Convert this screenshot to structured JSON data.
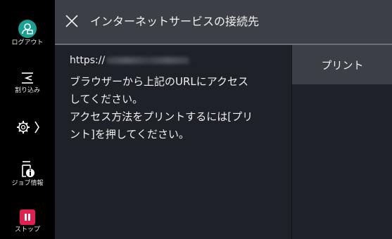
{
  "sidebar": {
    "items": [
      {
        "label": "ログアウト",
        "icon": "logout-user-icon"
      },
      {
        "label": "割り込み",
        "icon": "interrupt-icon"
      },
      {
        "label": "",
        "icon": "settings-gear-icon"
      },
      {
        "label": "ジョブ情報",
        "icon": "job-info-icon"
      },
      {
        "label": "ストップ",
        "icon": "stop-icon"
      }
    ]
  },
  "header": {
    "title": "インターネットサービスの接続先",
    "close_icon": "close-icon"
  },
  "content": {
    "url_prefix": "https://",
    "message_line1": "ブラウザーから上記のURLにアクセス",
    "message_line2": "してください。",
    "message_line3": "アクセス方法をプリントするには[プリ",
    "message_line4": "ント]を押してください。"
  },
  "actions": {
    "print_label": "プリント"
  },
  "colors": {
    "logout_accent": "#1aa093",
    "stop_accent": "#e0214f",
    "header_bg": "#3c3f46",
    "content_bg": "#1e2128"
  }
}
